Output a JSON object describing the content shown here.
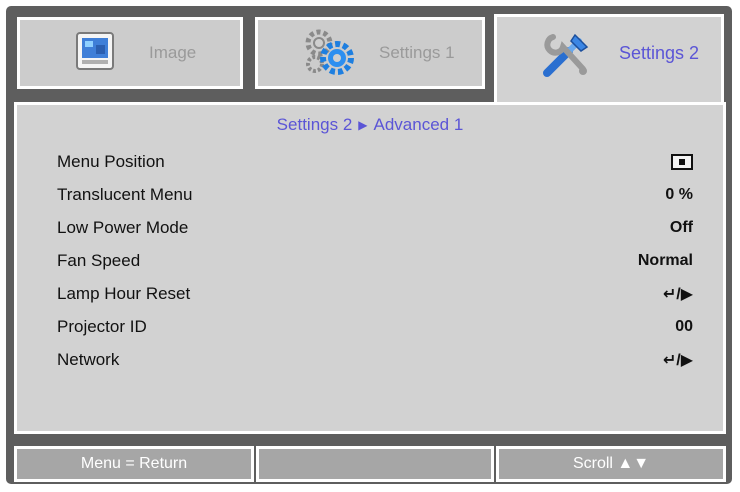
{
  "tabs": {
    "image": {
      "label": "Image",
      "icon": "image-icon"
    },
    "settings1": {
      "label": "Settings 1",
      "icon": "gears-icon"
    },
    "settings2": {
      "label": "Settings 2",
      "icon": "tools-icon"
    }
  },
  "breadcrumb": {
    "parent": "Settings 2",
    "separator": "▶",
    "current": "Advanced 1"
  },
  "menu": {
    "items": [
      {
        "label": "Menu Position",
        "value": "",
        "value_icon": "menu-position-icon"
      },
      {
        "label": "Translucent Menu",
        "value": "0 %"
      },
      {
        "label": "Low Power Mode",
        "value": "Off"
      },
      {
        "label": "Fan Speed",
        "value": "Normal"
      },
      {
        "label": "Lamp Hour Reset",
        "value": "↵/▶"
      },
      {
        "label": "Projector ID",
        "value": "00"
      },
      {
        "label": "Network",
        "value": "↵/▶"
      }
    ]
  },
  "footer": {
    "left": "Menu = Return",
    "middle": "",
    "right": "Scroll ▲▼"
  },
  "colors": {
    "accent": "#5b55d6",
    "frame": "#5e5e5e",
    "panel": "#d2d2d2",
    "footer": "#a6a6a6"
  }
}
